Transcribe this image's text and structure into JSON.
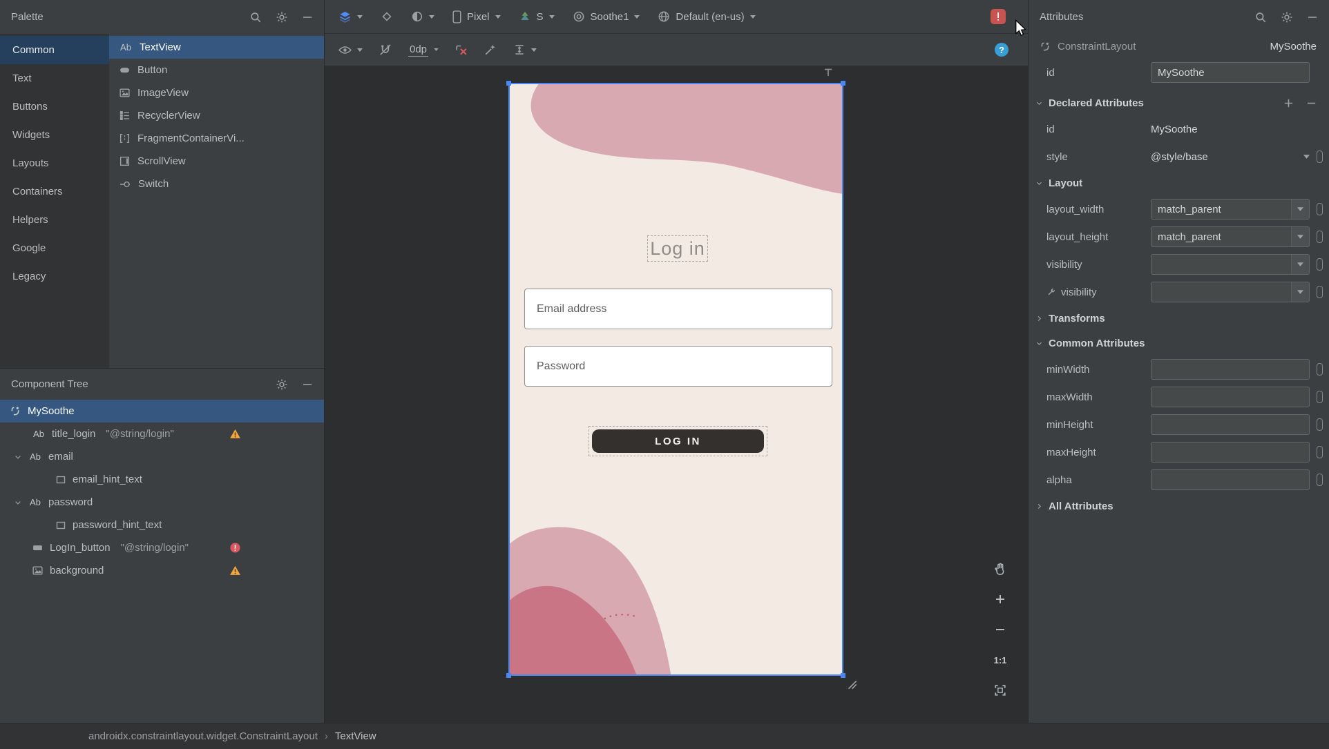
{
  "icons": {
    "textview_glyph": "Ab",
    "help_glyph": "?"
  },
  "palette": {
    "title": "Palette",
    "categories": [
      {
        "label": "Common"
      },
      {
        "label": "Text"
      },
      {
        "label": "Buttons"
      },
      {
        "label": "Widgets"
      },
      {
        "label": "Layouts"
      },
      {
        "label": "Containers"
      },
      {
        "label": "Helpers"
      },
      {
        "label": "Google"
      },
      {
        "label": "Legacy"
      }
    ],
    "selected_category": "Common",
    "components": [
      {
        "label": "TextView"
      },
      {
        "label": "Button"
      },
      {
        "label": "ImageView"
      },
      {
        "label": "RecyclerView"
      },
      {
        "label": "FragmentContainerVi..."
      },
      {
        "label": "ScrollView"
      },
      {
        "label": "Switch"
      }
    ],
    "selected_component": "TextView"
  },
  "component_tree": {
    "title": "Component Tree",
    "items": [
      {
        "label": "MySoothe"
      },
      {
        "label": "title_login",
        "value": "\"@string/login\"",
        "badge": "warning"
      },
      {
        "label": "email"
      },
      {
        "label": "email_hint_text"
      },
      {
        "label": "password"
      },
      {
        "label": "password_hint_text"
      },
      {
        "label": "LogIn_button",
        "value": "\"@string/login\"",
        "badge": "error"
      },
      {
        "label": "background",
        "badge": "warning"
      }
    ]
  },
  "device_toolbar": {
    "device": "Pixel",
    "api_level": "S",
    "theme": "Soothe1",
    "locale": "Default (en-us)"
  },
  "design_toolbar": {
    "default_margin": "0dp"
  },
  "canvas": {
    "zoom_ratio": "1:1",
    "screen": {
      "title": "Log in",
      "email_label": "Email address",
      "password_label": "Password",
      "login_button": "LOG IN"
    },
    "colors": {
      "screen_background": "#F2EAE3",
      "blob_pink": "#D9A9B2",
      "blob_rose": "#C97585",
      "button_dark": "#33302E",
      "selection_blue": "#4A87F5"
    }
  },
  "attributes": {
    "title": "Attributes",
    "component_type": "ConstraintLayout",
    "component_id": "MySoothe",
    "id_row": {
      "label": "id",
      "value": "MySoothe"
    },
    "declared": {
      "title": "Declared Attributes",
      "rows": [
        {
          "label": "id",
          "value": "MySoothe"
        },
        {
          "label": "style",
          "value": "@style/base"
        }
      ]
    },
    "layout": {
      "title": "Layout",
      "rows": [
        {
          "label": "layout_width",
          "value": "match_parent"
        },
        {
          "label": "layout_height",
          "value": "match_parent"
        },
        {
          "label": "visibility",
          "value": ""
        },
        {
          "label": "visibility",
          "value": ""
        }
      ]
    },
    "transforms": {
      "title": "Transforms"
    },
    "common": {
      "title": "Common Attributes",
      "rows": [
        {
          "label": "minWidth",
          "value": ""
        },
        {
          "label": "maxWidth",
          "value": ""
        },
        {
          "label": "minHeight",
          "value": ""
        },
        {
          "label": "maxHeight",
          "value": ""
        },
        {
          "label": "alpha",
          "value": ""
        }
      ]
    },
    "all": {
      "title": "All Attributes"
    }
  },
  "status_bar": {
    "path": "androidx.constraintlayout.widget.ConstraintLayout",
    "separator": "›",
    "leaf": "TextView"
  }
}
